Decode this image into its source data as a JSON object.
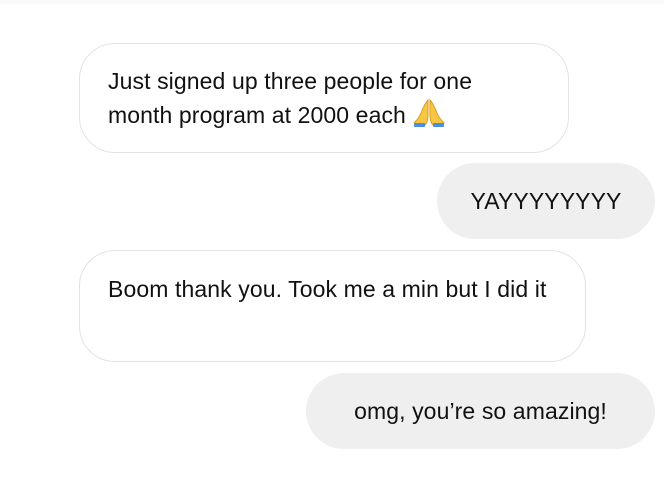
{
  "messages": [
    {
      "direction": "incoming",
      "text": "Just signed up three people for one month program at 2000 each",
      "emoji": "folded-hands"
    },
    {
      "direction": "outgoing",
      "text": "YAYYYYYYYY"
    },
    {
      "direction": "incoming",
      "text": "Boom thank you. Took me a min but I did it"
    },
    {
      "direction": "outgoing",
      "text": "omg, you’re so amazing!"
    }
  ],
  "colors": {
    "incoming_border": "#e3e3e3",
    "outgoing_background": "#efefef",
    "text": "#111111"
  }
}
